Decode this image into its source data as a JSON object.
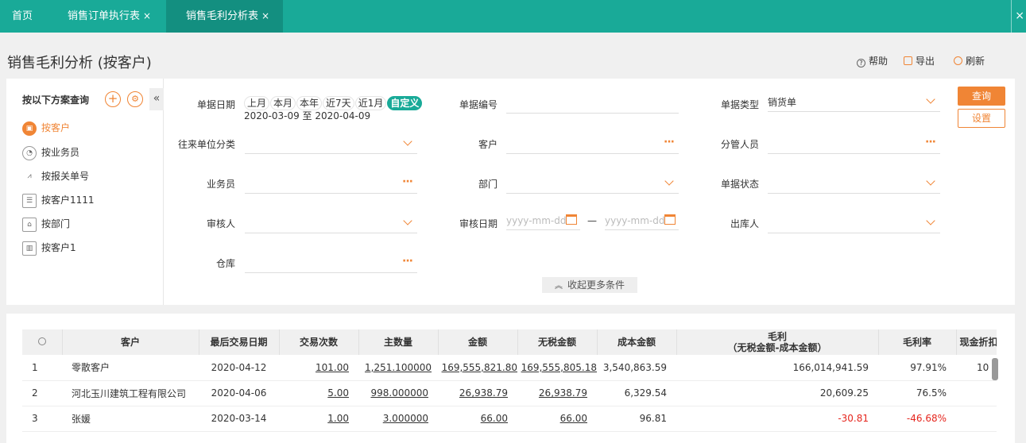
{
  "tabs": {
    "home": "首页",
    "order_exec": "销售订单执行表",
    "margin": "销售毛利分析表",
    "close": "×"
  },
  "header": {
    "title": "销售毛利分析 (按客户)",
    "help": "帮助",
    "export": "导出",
    "refresh": "刷新"
  },
  "scheme": {
    "title": "按以下方案查询",
    "add": "+",
    "collapse": "«",
    "items": [
      {
        "label": "按客户",
        "icon": "box-icon",
        "active": true
      },
      {
        "label": "按业务员",
        "icon": "clock-icon"
      },
      {
        "label": "按报关单号",
        "icon": "chart-icon"
      },
      {
        "label": "按客户1111",
        "icon": "card-icon"
      },
      {
        "label": "按部门",
        "icon": "department-icon"
      },
      {
        "label": "按客户1",
        "icon": "bar-chart-icon"
      }
    ]
  },
  "filters": {
    "doc_date_label": "单据日期",
    "chips": [
      "上月",
      "本月",
      "本年",
      "近7天",
      "近1月",
      "自定义"
    ],
    "date_range": "2020-03-09 至 2020-04-09",
    "doc_no_label": "单据编号",
    "doc_type_label": "单据类型",
    "doc_type_value": "销货单",
    "partner_class_label": "往来单位分类",
    "customer_label": "客户",
    "manager_label": "分管人员",
    "salesman_label": "业务员",
    "dept_label": "部门",
    "doc_status_label": "单据状态",
    "auditor_label": "审核人",
    "audit_date_label": "审核日期",
    "date_placeholder": "yyyy-mm-dd",
    "range_sep": "—",
    "shipper_label": "出库人",
    "warehouse_label": "仓库",
    "dots": "···",
    "query": "查询",
    "settings": "设置",
    "fold": "收起更多条件"
  },
  "table": {
    "headers": {
      "customer": "客户",
      "last_date": "最后交易日期",
      "count": "交易次数",
      "qty": "主数量",
      "amount": "金额",
      "net_amount": "无税金额",
      "cost": "成本金额",
      "margin_line1": "毛利",
      "margin_line2": "（无税金额-成本金额）",
      "margin_rate": "毛利率",
      "cash_discount": "现金折扣"
    },
    "rows": [
      {
        "no": "1",
        "customer": "零散客户",
        "last_date": "2020-04-12",
        "count": "101.00",
        "qty": "1,251.100000",
        "amount": "169,555,821.80",
        "net_amount": "169,555,805.18",
        "cost": "3,540,863.59",
        "margin": "166,014,941.59",
        "rate": "97.91%",
        "cash": "10",
        "negative": false
      },
      {
        "no": "2",
        "customer": "河北玉川建筑工程有限公司",
        "last_date": "2020-04-06",
        "count": "5.00",
        "qty": "998.000000",
        "amount": "26,938.79",
        "net_amount": "26,938.79",
        "cost": "6,329.54",
        "margin": "20,609.25",
        "rate": "76.5%",
        "cash": "",
        "negative": false
      },
      {
        "no": "3",
        "customer": "张媛",
        "last_date": "2020-03-14",
        "count": "1.00",
        "qty": "3.000000",
        "amount": "66.00",
        "net_amount": "66.00",
        "cost": "96.81",
        "margin": "-30.81",
        "rate": "-46.68%",
        "cash": "",
        "negative": true
      }
    ]
  },
  "colors": {
    "brand": "#19aa98",
    "accent": "#f08535",
    "negative": "#e5261e"
  }
}
